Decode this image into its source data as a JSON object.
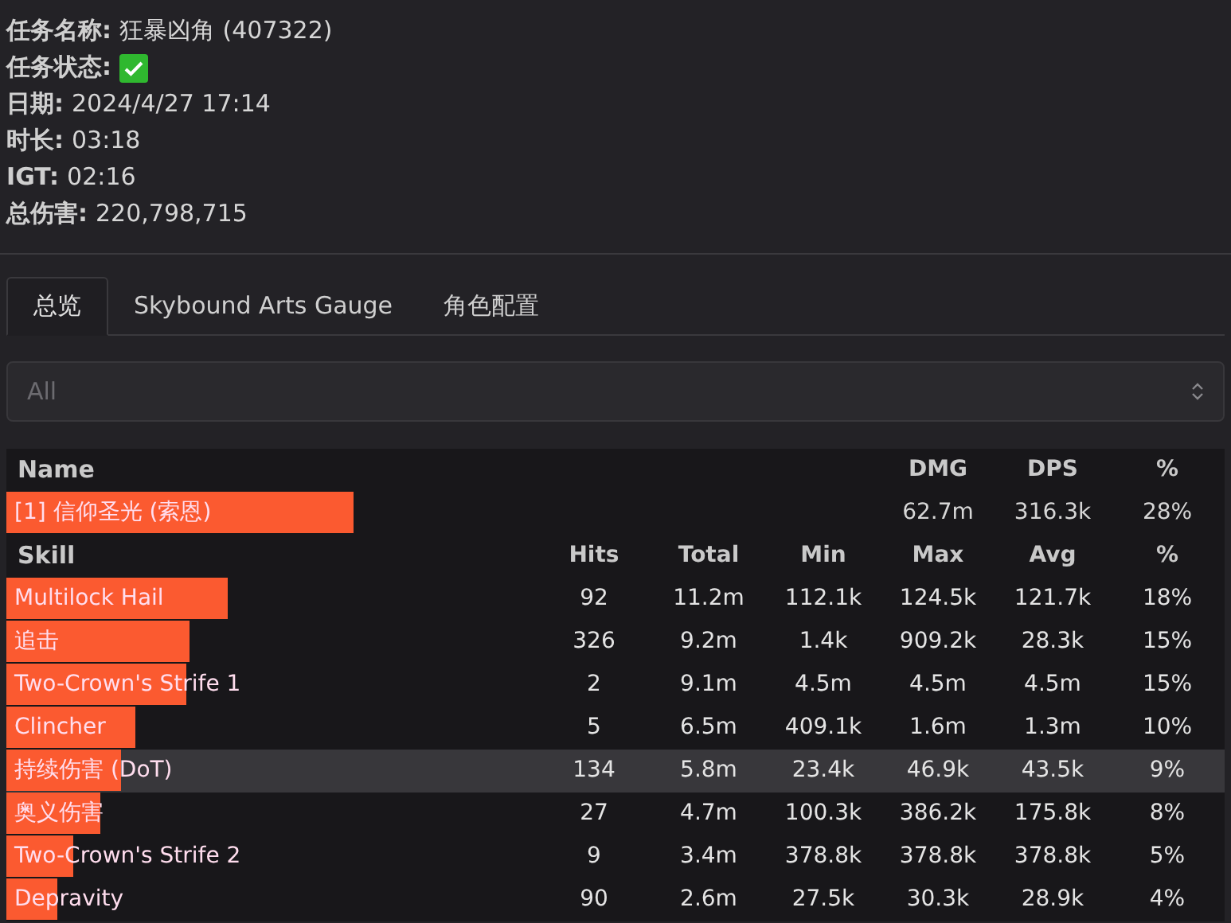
{
  "info": [
    {
      "label": "任务名称:",
      "value": "狂暴凶角 (407322)"
    },
    {
      "label": "任务状态:",
      "kind": "status",
      "completed": true
    },
    {
      "label": "日期:",
      "value": "2024/4/27 17:14"
    },
    {
      "label": "时长:",
      "value": "03:18"
    },
    {
      "label": "IGT:",
      "value": "02:16"
    },
    {
      "label": "总伤害:",
      "value": "220,798,715"
    }
  ],
  "tabs": [
    {
      "label": "总览",
      "selected": true
    },
    {
      "label": "Skybound Arts Gauge",
      "selected": false
    },
    {
      "label": "角色配置",
      "selected": false
    }
  ],
  "filter": {
    "placeholder": "All"
  },
  "player_table": {
    "columns": [
      "Name",
      "DMG",
      "DPS",
      "%"
    ],
    "rows": [
      {
        "name": "[1] 信仰圣光 (索恩)",
        "dmg": "62.7m",
        "dps": "316.3k",
        "pct": "28%",
        "level": 0.285
      }
    ]
  },
  "skill_table": {
    "columns": [
      "Skill",
      "Hits",
      "Total",
      "Min",
      "Max",
      "Avg",
      "%"
    ],
    "rows": [
      {
        "cells": [
          "Multilock Hail",
          "92",
          "11.2m",
          "112.1k",
          "124.5k",
          "121.7k",
          "18%"
        ],
        "level": 0.182,
        "selected": false
      },
      {
        "cells": [
          "追击",
          "326",
          "9.2m",
          "1.4k",
          "909.2k",
          "28.3k",
          "15%"
        ],
        "level": 0.15,
        "selected": false
      },
      {
        "cells": [
          "Two-Crown's Strife 1",
          "2",
          "9.1m",
          "4.5m",
          "4.5m",
          "4.5m",
          "15%"
        ],
        "level": 0.148,
        "selected": false
      },
      {
        "cells": [
          "Clincher",
          "5",
          "6.5m",
          "409.1k",
          "1.6m",
          "1.3m",
          "10%"
        ],
        "level": 0.106,
        "selected": false
      },
      {
        "cells": [
          "持续伤害 (DoT)",
          "134",
          "5.8m",
          "23.4k",
          "46.9k",
          "43.5k",
          "9%"
        ],
        "level": 0.094,
        "selected": true
      },
      {
        "cells": [
          "奥义伤害",
          "27",
          "4.7m",
          "100.3k",
          "386.2k",
          "175.8k",
          "8%"
        ],
        "level": 0.077,
        "selected": false
      },
      {
        "cells": [
          "Two-Crown's Strife 2",
          "9",
          "3.4m",
          "378.8k",
          "378.8k",
          "378.8k",
          "5%"
        ],
        "level": 0.055,
        "selected": false
      },
      {
        "cells": [
          "Depravity",
          "90",
          "2.6m",
          "27.5k",
          "30.3k",
          "28.9k",
          "4%"
        ],
        "level": 0.042,
        "selected": false
      }
    ]
  }
}
